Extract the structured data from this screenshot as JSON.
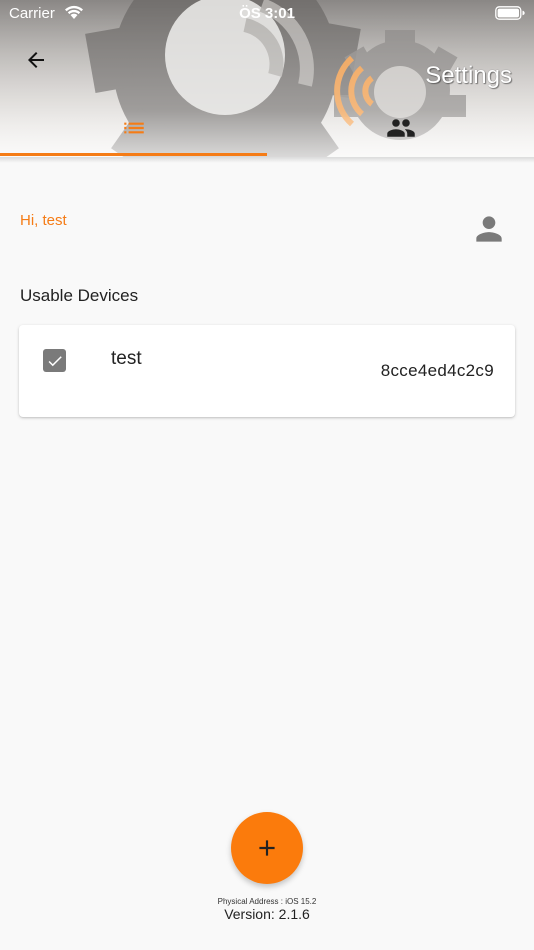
{
  "status_bar": {
    "carrier": "Carrier",
    "time": "ÖS 3:01"
  },
  "header": {
    "title": "Settings",
    "back_icon": "arrow-left-icon",
    "tabs": [
      {
        "id": "devices",
        "icon": "list-icon",
        "selected": true
      },
      {
        "id": "users",
        "icon": "people-icon",
        "selected": false
      }
    ]
  },
  "user": {
    "greeting": "Hi, test",
    "avatar_icon": "person-icon"
  },
  "devices_section": {
    "title": "Usable Devices",
    "items": [
      {
        "name": "test",
        "id": "8cce4ed4c2c9",
        "checked": true
      }
    ]
  },
  "fab": {
    "icon": "plus-icon"
  },
  "footer": {
    "physical_address": "Physical Address : iOS 15.2",
    "version": "Version: 2.1.6"
  },
  "colors": {
    "accent": "#f57c16",
    "fab": "#fb7b0c",
    "background": "#f9f9f9",
    "card": "#ffffff",
    "checkbox": "#7a7a7a"
  }
}
